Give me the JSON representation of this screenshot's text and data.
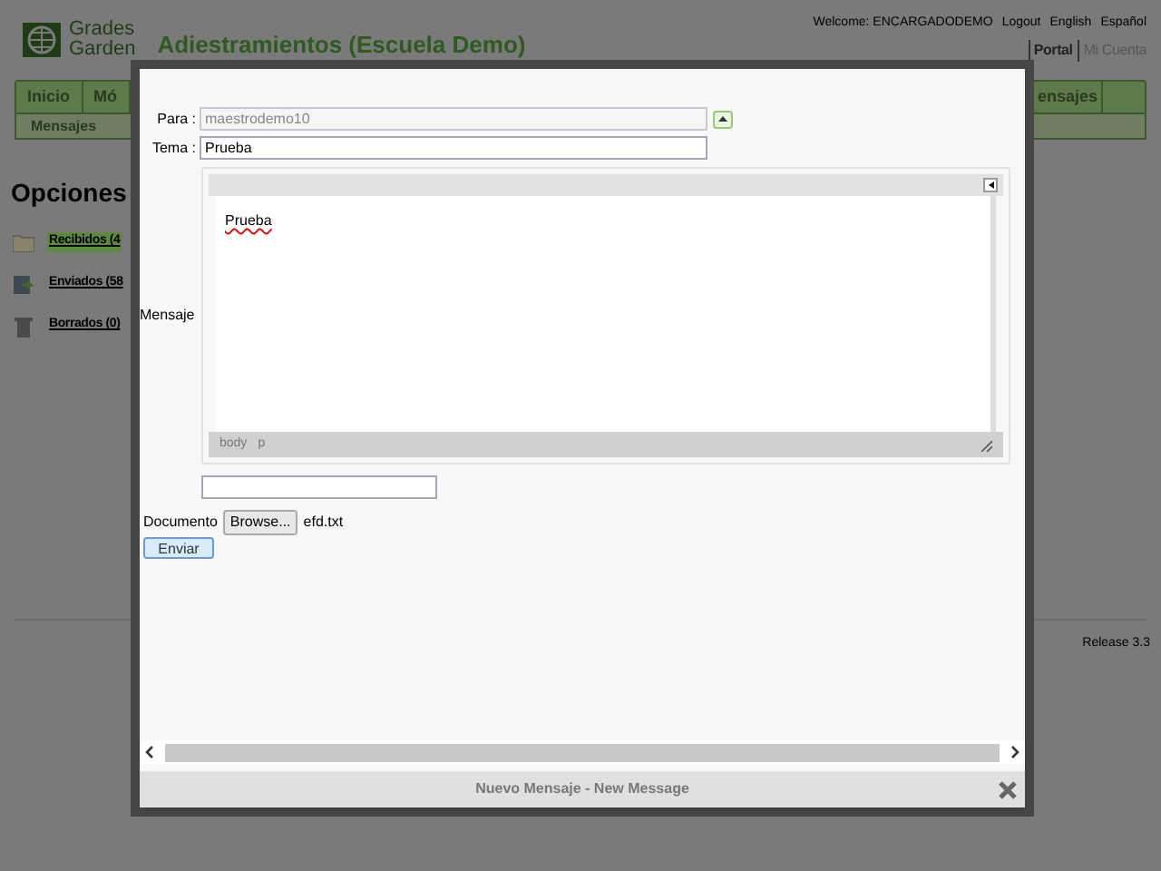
{
  "header": {
    "logo_line1": "Grades",
    "logo_line2": "Garden",
    "school_title": "Adiestramientos (Escuela Demo)",
    "welcome": "Welcome: ENCARGADODEMO",
    "links": [
      "Logout",
      "English",
      "Español"
    ],
    "portal_links": [
      {
        "label": "Portal",
        "selected": true
      },
      {
        "label": "Mi Cuenta",
        "selected": false
      }
    ]
  },
  "nav": {
    "tabs": [
      "Inicio",
      "Mó",
      "ensajes"
    ],
    "subnav": "Mensajes"
  },
  "sidebar": {
    "title": "Opciones",
    "items": [
      {
        "kind": "folder",
        "label": "Recibidos (4",
        "selected": true
      },
      {
        "kind": "sent",
        "label": "Enviados (58",
        "selected": false
      },
      {
        "kind": "trash",
        "label": "Borrados (0)",
        "selected": false
      }
    ]
  },
  "footer": {
    "release": "Release 3.3"
  },
  "dialog": {
    "title": "Nuevo Mensaje - New Message",
    "para_label": "Para :",
    "para_value": "maestrodemo10",
    "tema_label": "Tema :",
    "tema_value": "Prueba",
    "mensaje_label": "Mensaje",
    "editor_text": "Prueba",
    "editor_path": [
      "body",
      "p"
    ],
    "documento_label": "Documento",
    "browse": "Browse...",
    "file_name": "efd.txt",
    "send": "Enviar"
  }
}
